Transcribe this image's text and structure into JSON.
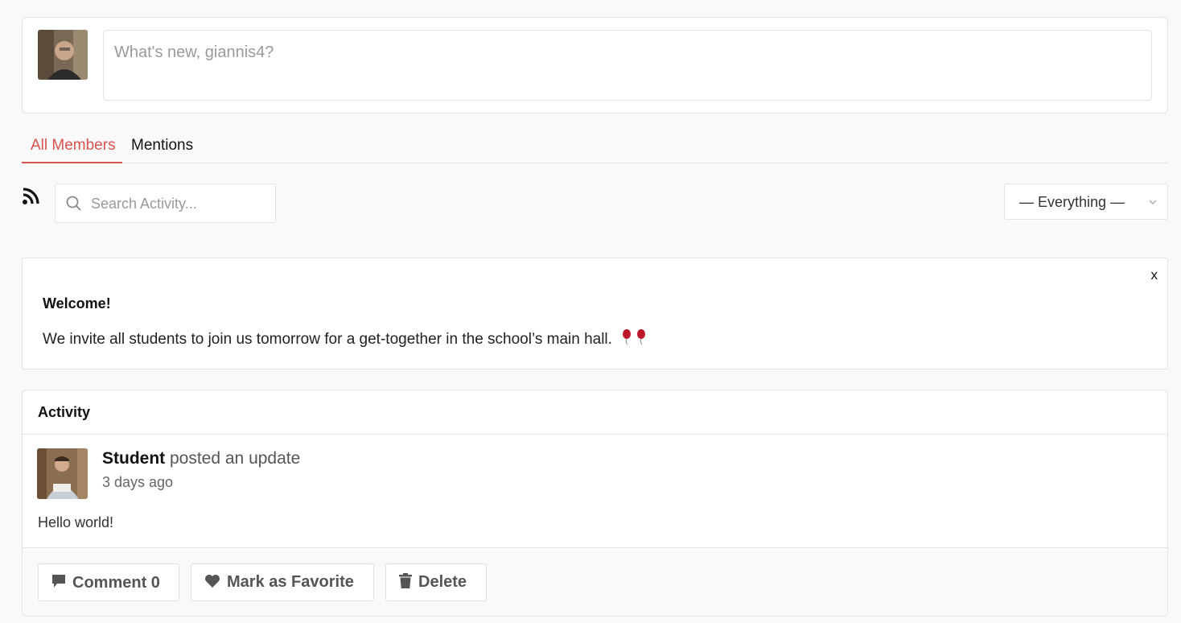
{
  "composer": {
    "avatar_icon": "user-avatar-icon",
    "placeholder": "What's new, giannis4?"
  },
  "tabs": [
    {
      "label": "All Members",
      "active": true
    },
    {
      "label": "Mentions",
      "active": false
    }
  ],
  "filters": {
    "rss_icon": "rss-icon",
    "search_placeholder": "Search Activity...",
    "show_value": "— Everything —"
  },
  "notice": {
    "close_label": "x",
    "title": "Welcome!",
    "body": "We invite all students to join us tomorrow for a get-together in the school’s main hall."
  },
  "activity": {
    "heading": "Activity",
    "item": {
      "author": "Student",
      "action": " posted an update",
      "time": "3 days ago",
      "content": "Hello world!",
      "buttons": {
        "comment": "Comment 0",
        "favorite": "Mark as Favorite",
        "delete": "Delete"
      }
    }
  },
  "colors": {
    "accent": "#d9534f",
    "border": "#e3e3e3",
    "background": "#f9f9f9"
  }
}
